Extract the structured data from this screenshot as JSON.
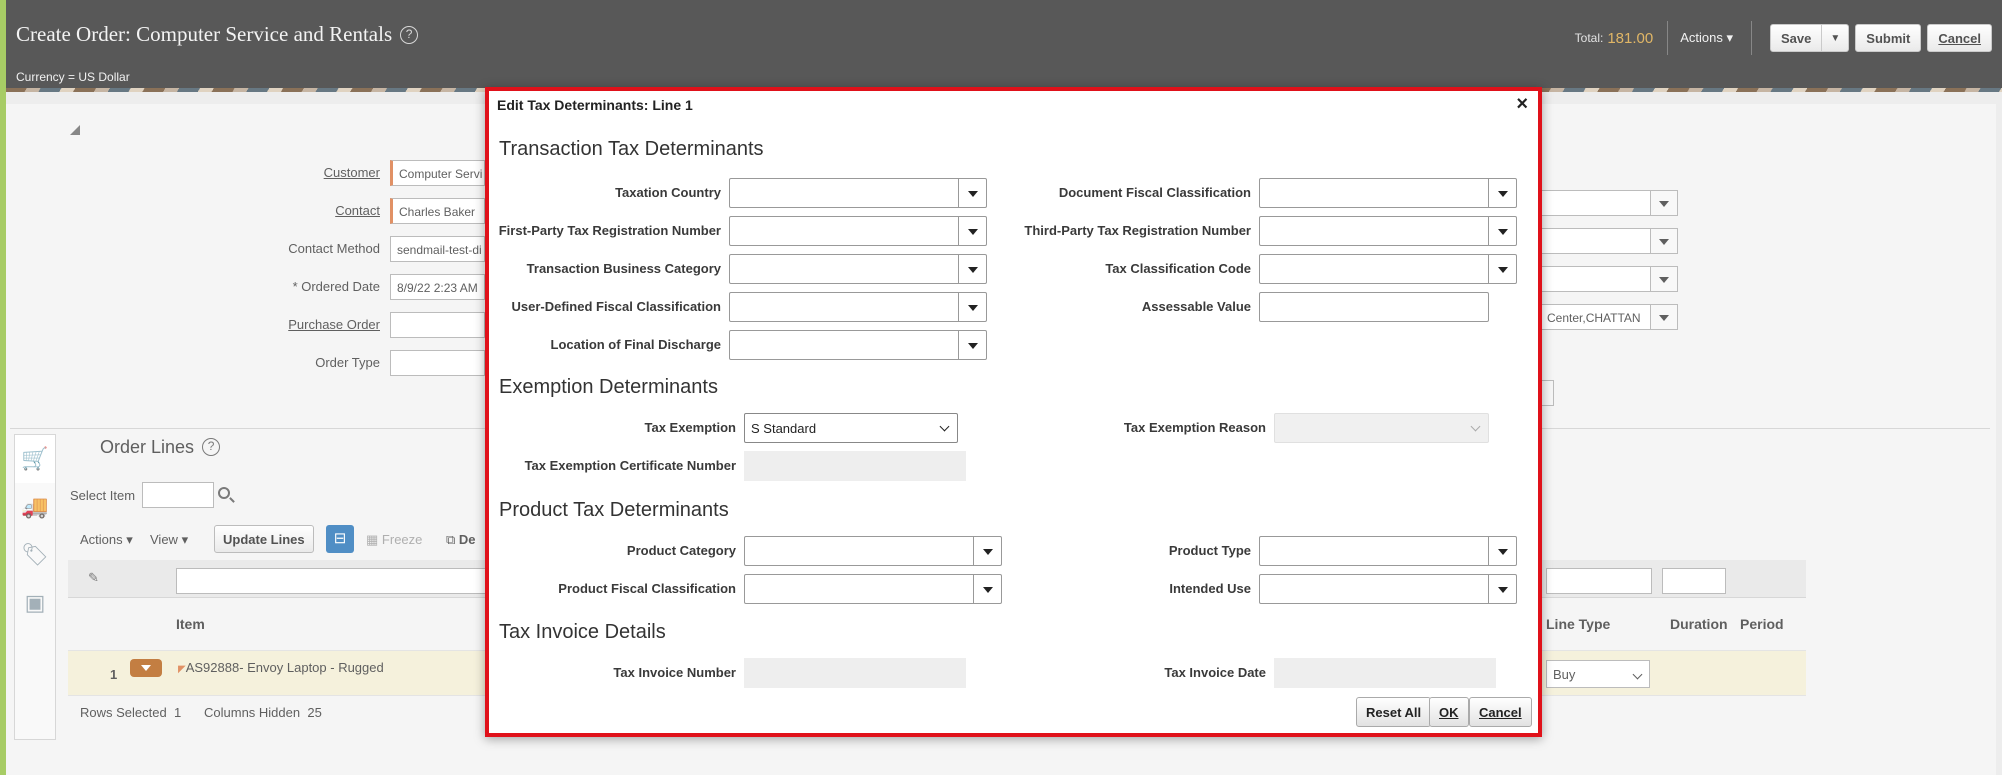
{
  "header": {
    "title": "Create Order: Computer Service and Rentals",
    "currency": "Currency = US Dollar",
    "total_label": "Total:",
    "total_value": "181.00",
    "actions_label": "Actions",
    "save_label": "Save",
    "submit_label": "Submit",
    "cancel_label": "Cancel"
  },
  "order_form": {
    "customer_label": "Customer",
    "customer_value": "Computer Servi",
    "contact_label": "Contact",
    "contact_value": "Charles Baker",
    "contact_method_label": "Contact Method",
    "contact_method_value": "sendmail-test-di",
    "ordered_date_label": "Ordered Date",
    "ordered_date_value": "8/9/22 2:23 AM",
    "purchase_order_label": "Purchase Order",
    "order_type_label": "Order Type",
    "right_field_value": "Center,CHATTAN"
  },
  "order_lines": {
    "title": "Order Lines",
    "select_item_label": "Select Item",
    "actions_label": "Actions",
    "view_label": "View",
    "update_lines_label": "Update Lines",
    "freeze_label": "Freeze",
    "detach_label": "De",
    "columns": {
      "item": "Item",
      "line_type": "Line Type",
      "duration": "Duration",
      "period": "Period"
    },
    "rows": [
      {
        "num": "1",
        "item": "AS92888- Envoy Laptop - Rugged",
        "line_type": "Buy"
      }
    ],
    "rows_selected_label": "Rows Selected",
    "rows_selected_value": "1",
    "columns_hidden_label": "Columns Hidden",
    "columns_hidden_value": "25"
  },
  "dialog": {
    "title": "Edit Tax Determinants: Line 1",
    "close_symbol": "×",
    "sections": {
      "transaction": "Transaction Tax Determinants",
      "exemption": "Exemption Determinants",
      "product": "Product Tax Determinants",
      "invoice": "Tax Invoice Details"
    },
    "labels": {
      "taxation_country": "Taxation Country",
      "first_party_reg": "First-Party Tax Registration Number",
      "txn_business_category": "Transaction Business Category",
      "user_fiscal_class": "User-Defined Fiscal Classification",
      "location_final_discharge": "Location of Final Discharge",
      "doc_fiscal_class": "Document Fiscal Classification",
      "third_party_reg": "Third-Party Tax Registration Number",
      "tax_class_code": "Tax Classification Code",
      "assessable_value": "Assessable Value",
      "tax_exemption": "Tax Exemption",
      "tax_exemption_reason": "Tax Exemption Reason",
      "tax_exemption_cert": "Tax Exemption Certificate Number",
      "product_category": "Product Category",
      "product_fiscal_class": "Product Fiscal Classification",
      "product_type": "Product Type",
      "intended_use": "Intended Use",
      "tax_invoice_number": "Tax Invoice Number",
      "tax_invoice_date": "Tax Invoice Date"
    },
    "values": {
      "tax_exemption": "S Standard"
    },
    "buttons": {
      "reset_all": "Reset All",
      "ok": "OK",
      "cancel": "Cancel"
    }
  }
}
